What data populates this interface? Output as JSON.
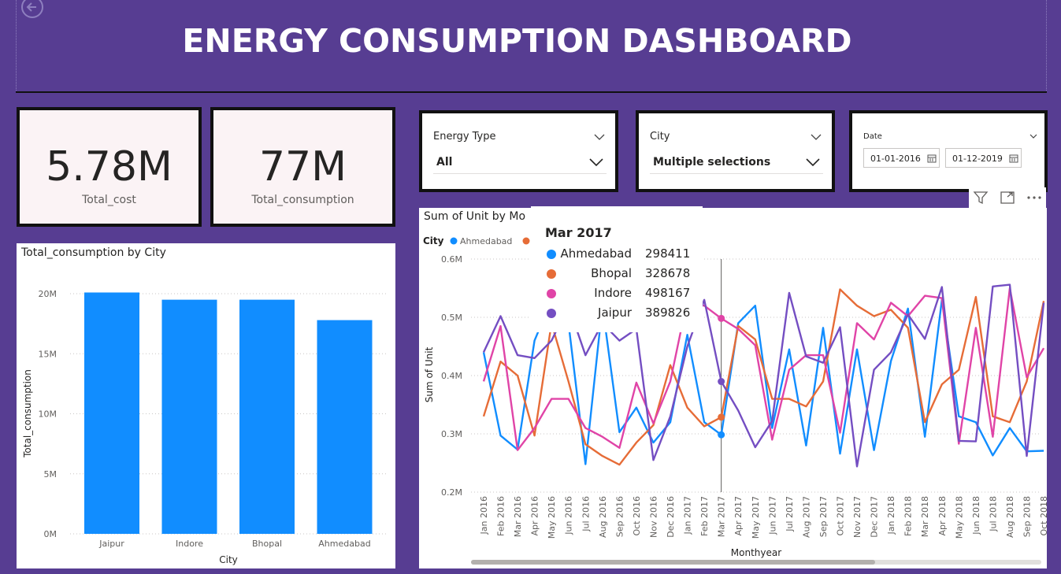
{
  "page": {
    "title": "ENERGY CONSUMPTION DASHBOARD"
  },
  "kpis": [
    {
      "value": "5.78M",
      "label": "Total_cost"
    },
    {
      "value": "77M",
      "label": "Total_consumption"
    }
  ],
  "slicers": {
    "energy_type": {
      "title": "Energy Type",
      "value": "All"
    },
    "city": {
      "title": "City",
      "value": "Multiple selections"
    },
    "date": {
      "title": "Date",
      "start": "01-01-2016",
      "end": "01-12-2019"
    }
  },
  "bar_chart_title": "Total_consumption by City",
  "line_chart_title": "Sum of Unit by Mo",
  "legend": {
    "title": "City",
    "first_item": "Ahmedabad"
  },
  "tooltip": {
    "title": "Mar 2017",
    "rows": [
      {
        "name": "Ahmedabad",
        "value": "298411",
        "color": "#118dff"
      },
      {
        "name": "Bhopal",
        "value": "328678",
        "color": "#e66c37"
      },
      {
        "name": "Indore",
        "value": "498167",
        "color": "#e044a7"
      },
      {
        "name": "Jaipur",
        "value": "389826",
        "color": "#744ec2"
      }
    ]
  },
  "colors": {
    "background": "#573d92",
    "bar": "#118dff",
    "ahmedabad": "#118dff",
    "bhopal": "#e66c37",
    "indore": "#e044a7",
    "jaipur": "#744ec2"
  },
  "icons": [
    "back-arrow-icon",
    "chevron-down-icon",
    "calendar-icon",
    "filter-icon",
    "focus-mode-icon",
    "more-options-icon"
  ],
  "chart_data": [
    {
      "type": "bar",
      "title": "Total_consumption by City",
      "categories": [
        "Jaipur",
        "Indore",
        "Bhopal",
        "Ahmedabad"
      ],
      "values": [
        20100000,
        19500000,
        19500000,
        17800000
      ],
      "xlabel": "City",
      "ylabel": "Total_consumption",
      "yticks": [
        "0M",
        "5M",
        "10M",
        "15M",
        "20M"
      ],
      "ylim": [
        0,
        20000000
      ],
      "grid": true
    },
    {
      "type": "line",
      "title": "Sum of Unit by Mo",
      "xlabel": "Monthyear",
      "ylabel": "Sum of Unit",
      "yticks": [
        "0.2M",
        "0.3M",
        "0.4M",
        "0.5M",
        "0.6M"
      ],
      "ylim": [
        200000,
        600000
      ],
      "grid": true,
      "x": [
        "Jan 2016",
        "Feb 2016",
        "Mar 2016",
        "Apr 2016",
        "May 2016",
        "Jun 2016",
        "Jul 2016",
        "Aug 2016",
        "Sep 2016",
        "Oct 2016",
        "Nov 2016",
        "Dec 2016",
        "Jan 2017",
        "Feb 2017",
        "Mar 2017",
        "Apr 2017",
        "May 2017",
        "Jun 2017",
        "Jul 2017",
        "Aug 2017",
        "Sep 2017",
        "Oct 2017",
        "Nov 2017",
        "Dec 2017",
        "Jan 2018",
        "Feb 2018",
        "Mar 2018",
        "Apr 2018",
        "May 2018",
        "Jun 2018",
        "Jul 2018",
        "Aug 2018",
        "Sep 2018",
        "Oct 2018"
      ],
      "series": [
        {
          "name": "Ahmedabad",
          "values": [
            440000,
            297000,
            273000,
            460000,
            530000,
            490000,
            248000,
            520000,
            303000,
            345000,
            285000,
            320000,
            470000,
            320000,
            298411,
            490000,
            520000,
            310000,
            445000,
            280000,
            482000,
            266000,
            445000,
            272000,
            425000,
            515000,
            295000,
            530000,
            330000,
            320000,
            263000,
            310000,
            270000,
            271000
          ]
        },
        {
          "name": "Bhopal",
          "values": [
            330000,
            424000,
            400000,
            297000,
            490000,
            390000,
            282000,
            262000,
            247000,
            285000,
            315000,
            418000,
            345000,
            313000,
            328678,
            485000,
            462000,
            360000,
            360000,
            347000,
            390000,
            548000,
            520000,
            502000,
            513000,
            482000,
            320000,
            385000,
            410000,
            535000,
            330000,
            320000,
            390000,
            528000
          ]
        },
        {
          "name": "Indore",
          "values": [
            390000,
            485000,
            272000,
            310000,
            360000,
            360000,
            310000,
            295000,
            276000,
            388000,
            318000,
            390000,
            530000,
            520000,
            498167,
            480000,
            452000,
            290000,
            410000,
            435000,
            435000,
            302000,
            490000,
            462000,
            525000,
            502000,
            537000,
            533000,
            283000,
            482000,
            295000,
            550000,
            397000,
            447000
          ]
        },
        {
          "name": "Jaipur",
          "values": [
            440000,
            502000,
            435000,
            430000,
            460000,
            520000,
            435000,
            490000,
            460000,
            480000,
            255000,
            330000,
            450000,
            530000,
            389826,
            340000,
            277000,
            322000,
            542000,
            433000,
            422000,
            483000,
            244000,
            410000,
            440000,
            505000,
            463000,
            552000,
            288000,
            287000,
            553000,
            556000,
            262000,
            525000
          ]
        }
      ],
      "tooltip_x": "Mar 2017",
      "visible_legend": [
        "Ahmedabad"
      ]
    }
  ]
}
